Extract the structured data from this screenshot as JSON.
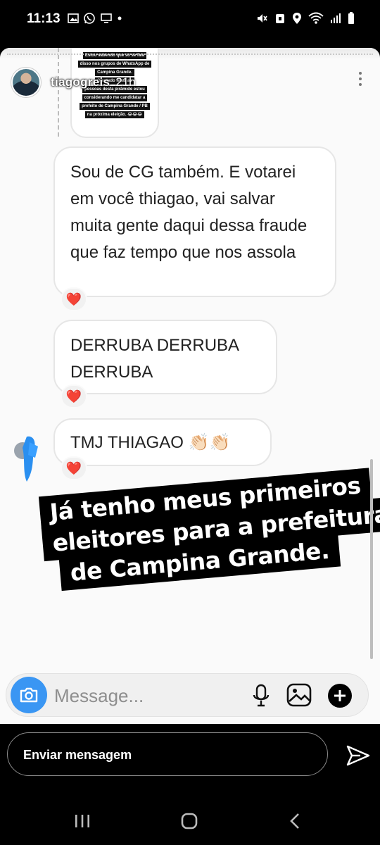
{
  "status_bar": {
    "time": "11:13",
    "left_icons": [
      "gallery-icon",
      "whatsapp-icon",
      "monitor-icon",
      "dot-icon"
    ],
    "right_icons": [
      "mute-icon",
      "alarm-icon",
      "location-icon",
      "wifi-icon",
      "signal-icon",
      "battery-icon"
    ]
  },
  "story": {
    "username": "tiagogreis",
    "time_ago": "21h",
    "shared_image_lines": [
      "Estou sabendo que só se fala",
      "disso nos grupos de WhatsApp de",
      "Campina Grande.",
      "O estado levar ao",
      "pessoas desta pirâmide estou",
      "considerando me candidatar a",
      "prefeito de Campina Grande / PB",
      "na próxima eleição. 😂😂😂"
    ],
    "messages": [
      {
        "text": "Sou de CG também. E votarei em você thiagao, vai salvar muita gente daqui dessa fraude que faz tempo que nos assola",
        "reaction": "❤️"
      },
      {
        "text": "DERRUBA DERRUBA DERRUBA",
        "reaction": "❤️"
      },
      {
        "text": "TMJ THIAGAO 👏🏻👏🏻",
        "reaction": "❤️"
      }
    ],
    "caption_lines": [
      "Já tenho meus primeiros",
      "eleitores para a prefeitura",
      "de Campina Grande."
    ],
    "composer": {
      "placeholder": "Message...",
      "icons": [
        "camera-icon",
        "microphone-icon",
        "gallery-icon",
        "plus-icon"
      ]
    }
  },
  "reply": {
    "placeholder": "Enviar mensagem",
    "send_icon": "send-icon"
  },
  "nav": {
    "buttons": [
      "recents-icon",
      "home-icon",
      "back-icon"
    ]
  },
  "colors": {
    "camera_button": "#3a96f3",
    "heart": "#e0245e",
    "caption_bg": "#000000"
  }
}
